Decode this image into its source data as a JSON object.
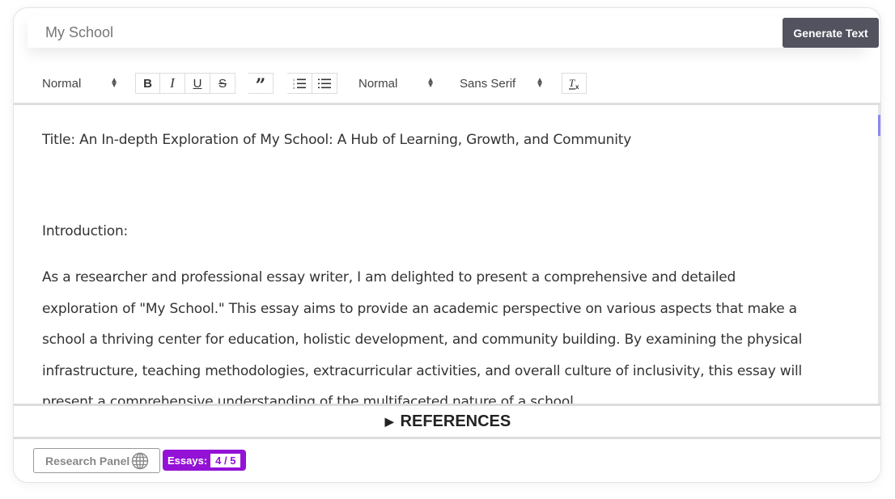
{
  "topbar": {
    "title_value": "My School",
    "generate_label": "Generate Text"
  },
  "toolbar": {
    "header_select": "Normal",
    "size_select": "Normal",
    "font_select": "Sans Serif",
    "buttons": {
      "bold": "B",
      "italic": "I",
      "underline": "U",
      "strike": "S",
      "quote": "”",
      "ordered_list": "ordered-list-icon",
      "bullet_list": "bullet-list-icon",
      "clear_format": "clear-format-icon"
    }
  },
  "editor": {
    "title_line": "Title: An In-depth Exploration of My School: A Hub of Learning, Growth, and Community",
    "intro_heading": "Introduction:",
    "paragraph_lines": [
      "As a researcher and professional essay writer, I am delighted to present a comprehensive and detailed",
      "exploration of \"My School.\" This essay aims to provide an academic perspective on various aspects that make a",
      "school a thriving center for education, holistic development, and community building. By examining the physical",
      "infrastructure, teaching methodologies, extracurricular activities, and overall culture of inclusivity, this essay will",
      "present a comprehensive understanding of the multifaceted nature of a school."
    ]
  },
  "references": {
    "label": "REFERENCES"
  },
  "footer": {
    "research_panel_label": "Research Panel",
    "essays_label": "Essays:",
    "essays_count": "4 / 5"
  },
  "colors": {
    "generate_button": "#53535f",
    "scroll_thumb": "#8b88f0",
    "essays_badge": "#9412d6"
  }
}
